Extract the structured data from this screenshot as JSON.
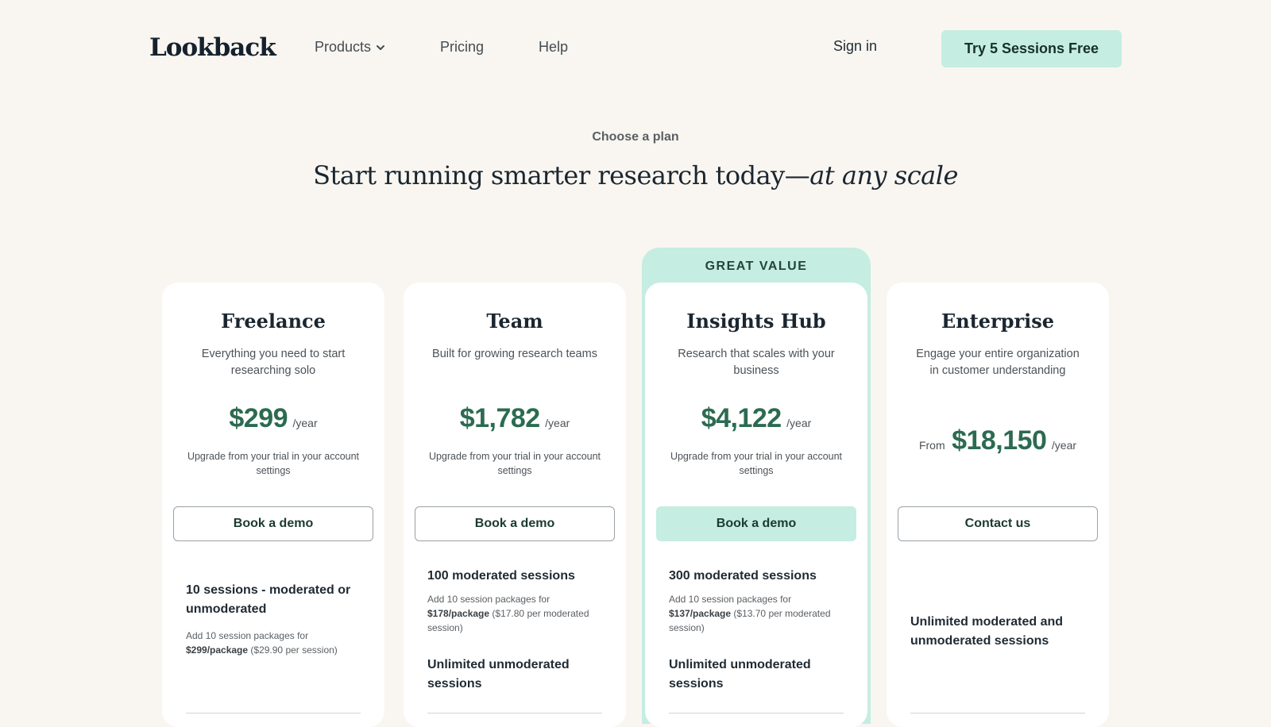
{
  "header": {
    "logo": "Lookback",
    "nav": {
      "products": "Products",
      "pricing": "Pricing",
      "help": "Help"
    },
    "sign_in": "Sign in",
    "cta": "Try 5 Sessions Free"
  },
  "hero": {
    "eyebrow": "Choose a plan",
    "headline_main": "Start running smarter research today—",
    "headline_italic": "at any scale"
  },
  "badge": "GREAT VALUE",
  "plans": [
    {
      "name": "Freelance",
      "description": "Everything you need to start researching solo",
      "price": "$299",
      "period": "/year",
      "note": "Upgrade from your trial in your account settings",
      "button": "Book a demo",
      "feature_1": "10 sessions - moderated or unmoderated",
      "addon_prefix": "Add 10 session packages for",
      "addon_price": "$299/package",
      "addon_detail": "($29.90 per session)"
    },
    {
      "name": "Team",
      "description": "Built for growing research teams",
      "price": "$1,782",
      "period": "/year",
      "note": "Upgrade from your trial in your account settings",
      "button": "Book a demo",
      "feature_1": "100 moderated sessions",
      "addon_prefix": "Add 10 session packages for",
      "addon_price": "$178/package",
      "addon_detail": "($17.80 per moderated session)",
      "feature_2": "Unlimited unmoderated sessions"
    },
    {
      "name": "Insights Hub",
      "description": "Research that scales with your business",
      "price": "$4,122",
      "period": "/year",
      "note": "Upgrade from your trial in your account settings",
      "button": "Book a demo",
      "feature_1": "300 moderated sessions",
      "addon_prefix": "Add 10 session packages for",
      "addon_price": "$137/package",
      "addon_detail": "($13.70 per moderated session)",
      "feature_2": "Unlimited unmoderated sessions"
    },
    {
      "name": "Enterprise",
      "description": "Engage your entire organization in customer understanding",
      "price_prefix": "From",
      "price": "$18,150",
      "period": "/year",
      "button": "Contact us",
      "feature_1": "Unlimited moderated and unmoderated sessions"
    }
  ],
  "colors": {
    "background": "#f9f6f1",
    "accent_mint": "#c5ede1",
    "price_green": "#2c6b51"
  }
}
